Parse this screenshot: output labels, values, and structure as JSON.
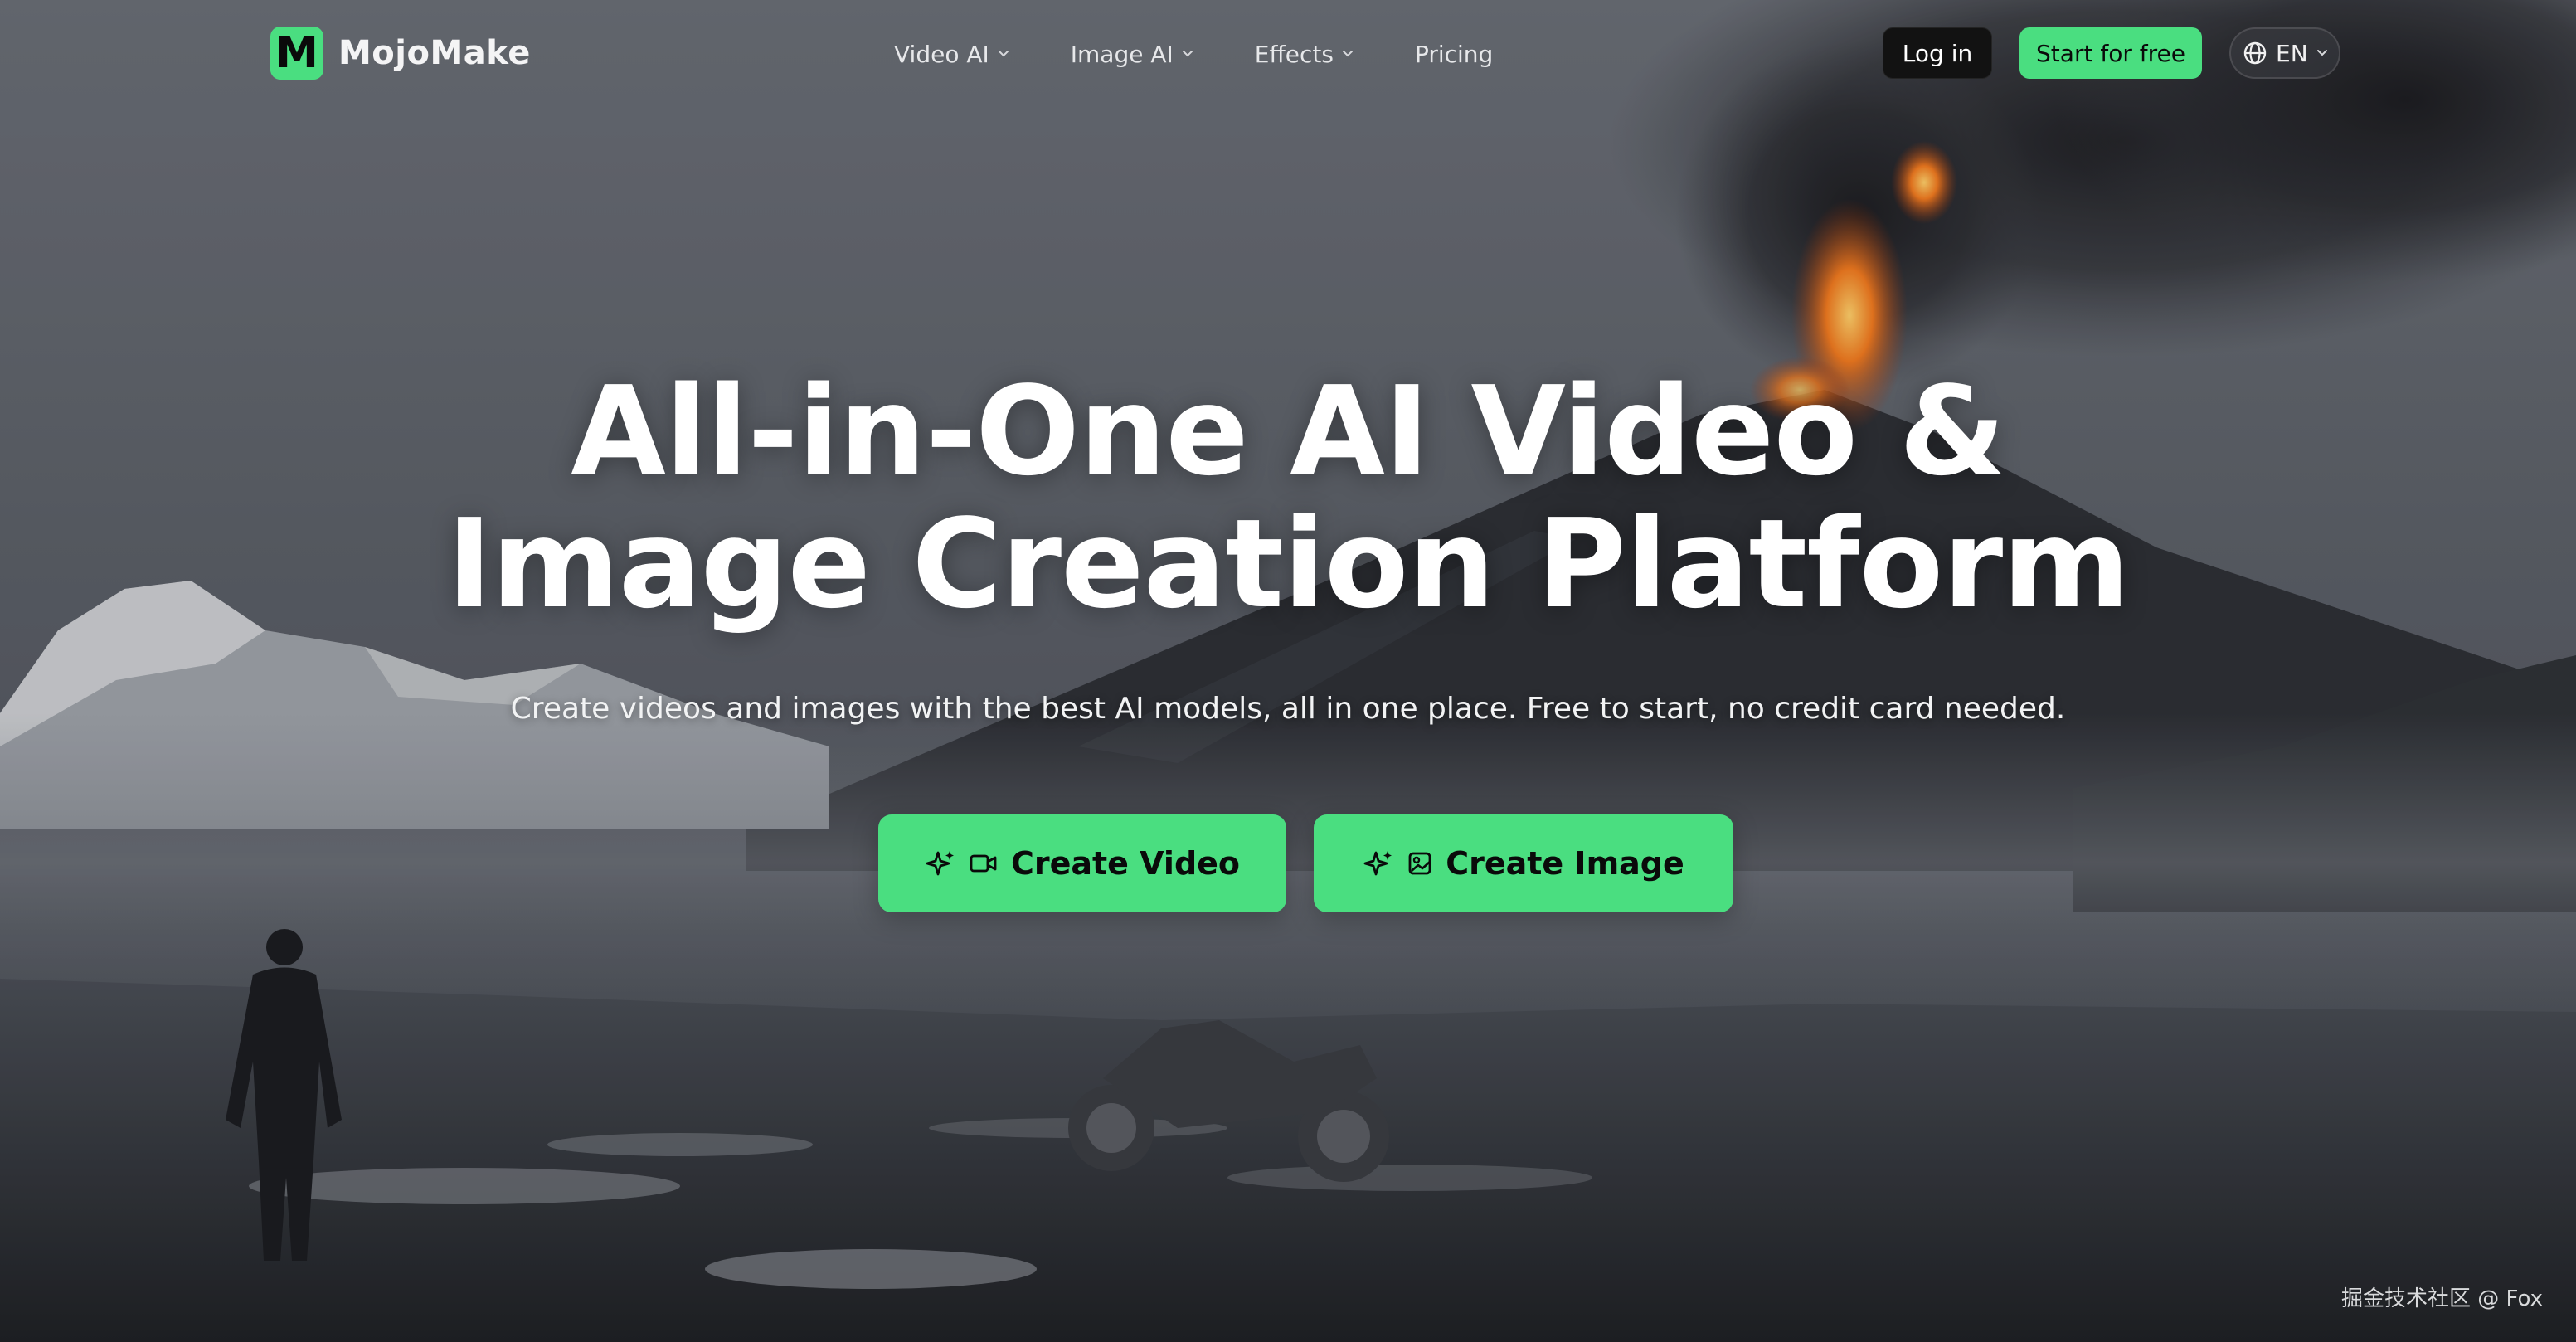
{
  "brand": {
    "logo_letter": "M",
    "name": "MojoMake",
    "accent_color": "#4ade80"
  },
  "nav": {
    "items": [
      {
        "label": "Video AI",
        "has_dropdown": true
      },
      {
        "label": "Image AI",
        "has_dropdown": true
      },
      {
        "label": "Effects",
        "has_dropdown": true
      },
      {
        "label": "Pricing",
        "has_dropdown": false
      }
    ],
    "login_label": "Log in",
    "start_label": "Start for free",
    "language": {
      "icon": "globe-icon",
      "selected": "EN"
    }
  },
  "hero": {
    "title_line1": "All-in-One AI Video &",
    "title_line2": "Image Creation Platform",
    "subtitle": "Create videos and images with the best AI models, all in one place. Free to start, no credit card needed.",
    "cta_video": {
      "label": "Create Video",
      "icons": [
        "sparkle-icon",
        "video-camera-icon"
      ]
    },
    "cta_image": {
      "label": "Create Image",
      "icons": [
        "sparkle-icon",
        "image-icon"
      ]
    }
  },
  "background": {
    "description_icon": "volcano-landscape-image"
  },
  "watermark": "掘金技术社区 @ Fox"
}
